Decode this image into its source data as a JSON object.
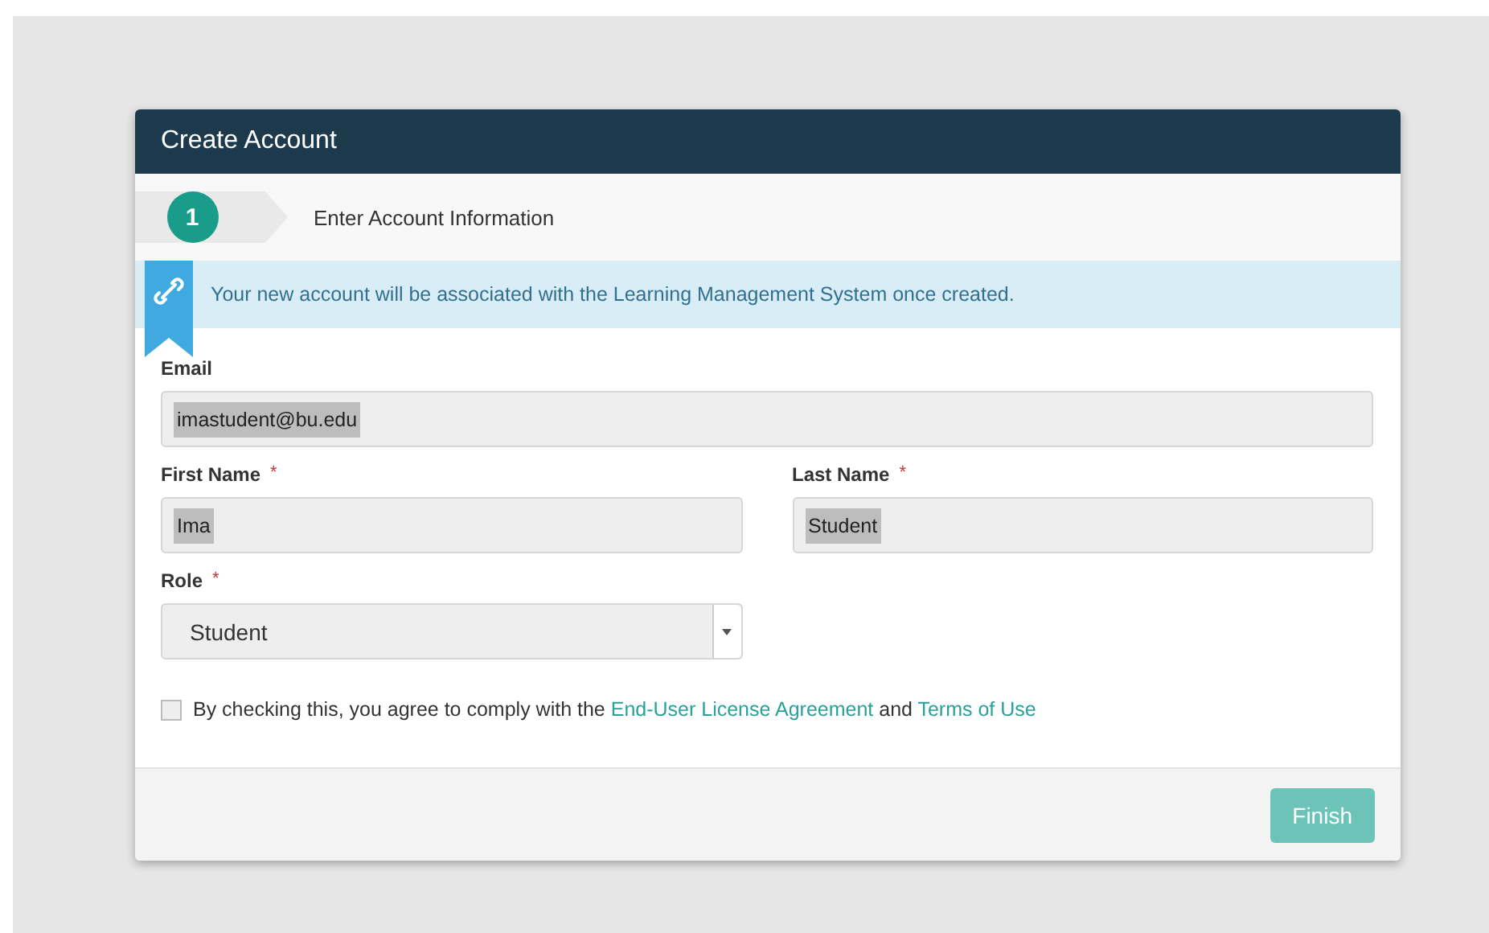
{
  "window": {
    "title": "Create Account"
  },
  "steps": [
    {
      "number": "1",
      "label": "Enter Account Information",
      "selected": true
    }
  ],
  "alert": {
    "text": "Your new account will be associated with the Learning Management System once created."
  },
  "fields": [
    {
      "kind": "text",
      "label": "Email",
      "value": "imastudent@bu.edu",
      "highlighted": true
    },
    {
      "kind": "text",
      "label": "First Name",
      "required_mark": "*",
      "value": "Ima",
      "highlighted": true
    },
    {
      "kind": "text",
      "label": "Last Name",
      "required_mark": "*",
      "value": "Student",
      "highlighted": true
    },
    {
      "kind": "select",
      "label": "Role",
      "required_mark": "*",
      "value": "Student",
      "highlighted": false
    }
  ],
  "agreement": {
    "checked": false,
    "parts": [
      {
        "kind": "text",
        "text": "By checking this, you agree to comply with the "
      },
      {
        "kind": "link",
        "text": "End-User License Agreement"
      },
      {
        "kind": "text",
        "text": " and "
      },
      {
        "kind": "link",
        "text": "Terms of Use"
      }
    ]
  },
  "buttons": [
    {
      "label": "Finish",
      "disabled": true
    }
  ]
}
